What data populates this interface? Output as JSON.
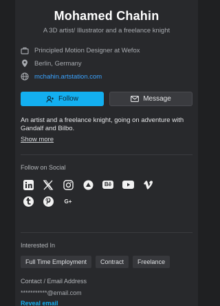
{
  "profile": {
    "name": "Mohamed Chahin",
    "tagline": "A 3D artist/ Illustrator and a freelance knight",
    "job": "Principled Motion Designer at Wefox",
    "location": "Berlin, Germany",
    "website": "mchahin.artstation.com"
  },
  "actions": {
    "follow_label": "Follow",
    "message_label": "Message"
  },
  "bio": {
    "text": "An artist and a freelance knight, going on adventure with Gandalf and Bilbo.",
    "show_more": "Show more"
  },
  "social": {
    "title": "Follow on Social",
    "icons": [
      "linkedin-icon",
      "x-icon",
      "instagram-icon",
      "artstation-icon",
      "behance-icon",
      "youtube-icon",
      "vimeo-icon",
      "tumblr-icon",
      "pinterest-icon",
      "google-plus-icon"
    ],
    "behance_text": "Bē",
    "google_text": "G+"
  },
  "interests": {
    "title": "Interested In",
    "tags": [
      "Full Time Employment",
      "Contract",
      "Freelance"
    ]
  },
  "contact": {
    "title": "Contact / Email Address",
    "email": "***********@email.com",
    "reveal": "Reveal email"
  },
  "colors": {
    "accent": "#13aff0",
    "background": "#28292c"
  }
}
